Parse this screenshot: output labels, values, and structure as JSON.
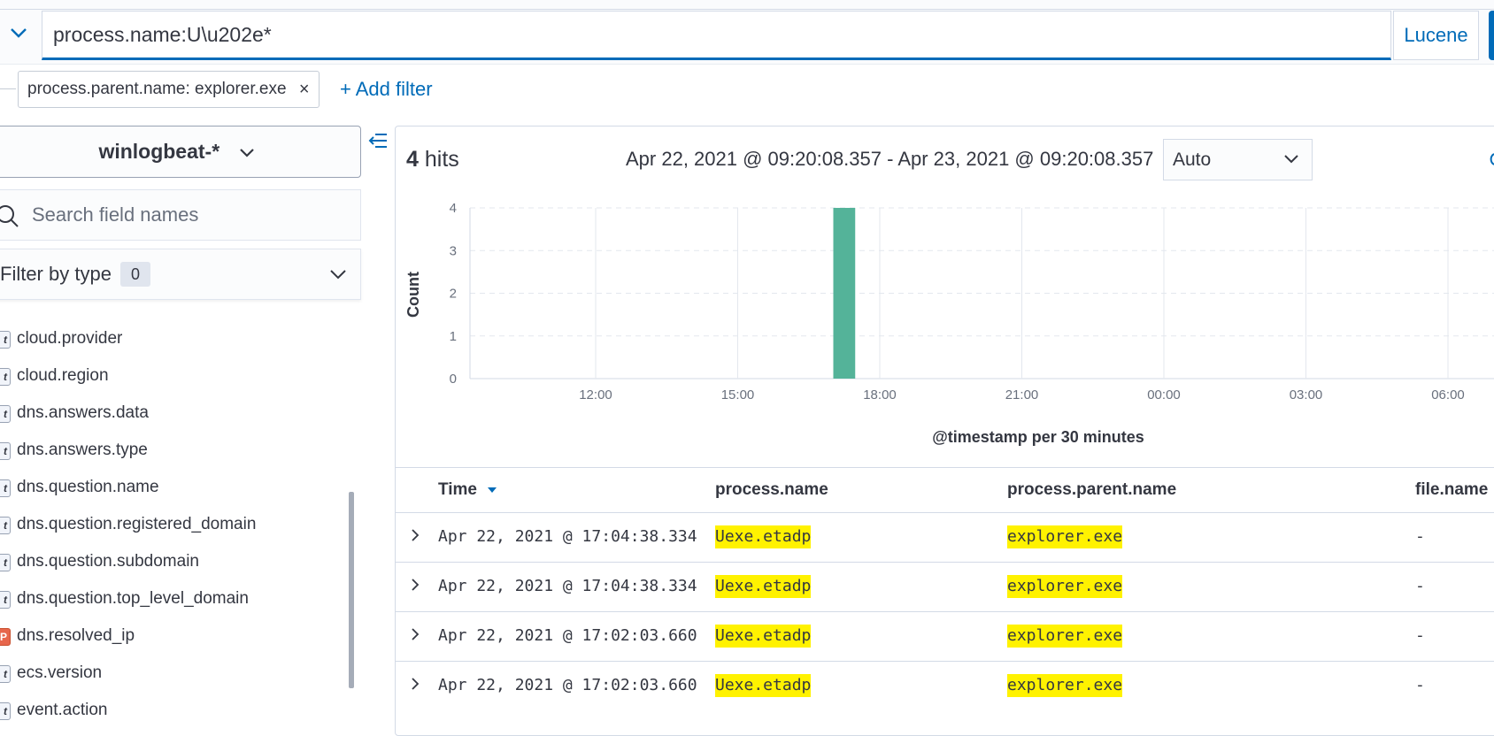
{
  "query_bar": {
    "query": "process.name:U\\u202e*",
    "language_button": "Lucene"
  },
  "filters": {
    "pills": [
      {
        "label": "process.parent.name: explorer.exe"
      }
    ],
    "add_filter_label": "+ Add filter"
  },
  "sidebar": {
    "index_pattern": "winlogbeat-*",
    "search_placeholder": "Search field names",
    "filter_by_type_label": "Filter by type",
    "filter_by_type_count": "0",
    "fields": [
      {
        "name": "cloud.provider",
        "type_icon": "t"
      },
      {
        "name": "cloud.region",
        "type_icon": "t"
      },
      {
        "name": "dns.answers.data",
        "type_icon": "t"
      },
      {
        "name": "dns.answers.type",
        "type_icon": "t"
      },
      {
        "name": "dns.question.name",
        "type_icon": "t"
      },
      {
        "name": "dns.question.registered_domain",
        "type_icon": "t"
      },
      {
        "name": "dns.question.subdomain",
        "type_icon": "t"
      },
      {
        "name": "dns.question.top_level_domain",
        "type_icon": "t"
      },
      {
        "name": "dns.resolved_ip",
        "type_icon": "IP"
      },
      {
        "name": "ecs.version",
        "type_icon": "t"
      },
      {
        "name": "event.action",
        "type_icon": "t"
      }
    ]
  },
  "results": {
    "hits_number": "4",
    "hits_label": "hits",
    "time_range": "Apr 22, 2021 @ 09:20:08.357 - Apr 23, 2021 @ 09:20:08.357",
    "interval": "Auto"
  },
  "chart_data": {
    "type": "bar",
    "xlabel": "@timestamp per 30 minutes",
    "ylabel": "Count",
    "ylim": [
      0,
      4
    ],
    "yticks": [
      0,
      1,
      2,
      3,
      4
    ],
    "x_ticks": [
      "12:00",
      "15:00",
      "18:00",
      "21:00",
      "00:00",
      "03:00",
      "06:00"
    ],
    "bars": [
      {
        "bucket_start": "17:00",
        "value": 4
      }
    ],
    "grid": true,
    "bar_color": "#54b399"
  },
  "table": {
    "columns": [
      "Time",
      "process.name",
      "process.parent.name",
      "file.name"
    ],
    "rows": [
      {
        "time": "Apr 22, 2021 @ 17:04:38.334",
        "process_name": "Uexe.etadp",
        "parent_name": "explorer.exe",
        "file_name": "-"
      },
      {
        "time": "Apr 22, 2021 @ 17:04:38.334",
        "process_name": "Uexe.etadp",
        "parent_name": "explorer.exe",
        "file_name": "-"
      },
      {
        "time": "Apr 22, 2021 @ 17:02:03.660",
        "process_name": "Uexe.etadp",
        "parent_name": "explorer.exe",
        "file_name": "-"
      },
      {
        "time": "Apr 22, 2021 @ 17:02:03.660",
        "process_name": "Uexe.etadp",
        "parent_name": "explorer.exe",
        "file_name": "-"
      }
    ]
  },
  "colors": {
    "accent": "#006bb8",
    "highlight": "#fff200",
    "bar": "#54b399"
  }
}
